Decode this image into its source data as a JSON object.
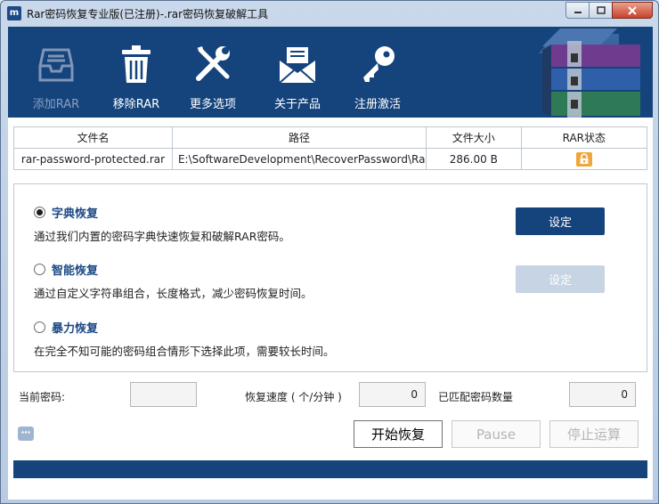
{
  "window": {
    "title": "Rar密码恢复专业版(已注册)-.rar密码恢复破解工具",
    "app_icon_text": "m"
  },
  "toolbar": {
    "items": [
      {
        "label": "添加RAR",
        "icon": "inbox-tray-icon",
        "enabled": false
      },
      {
        "label": "移除RAR",
        "icon": "trash-icon",
        "enabled": true
      },
      {
        "label": "更多选项",
        "icon": "tools-icon",
        "enabled": true
      },
      {
        "label": "关于产品",
        "icon": "envelope-icon",
        "enabled": true
      },
      {
        "label": "注册激活",
        "icon": "key-icon",
        "enabled": true
      }
    ],
    "logo": "rar-archive-logo"
  },
  "file_table": {
    "headers": [
      "文件名",
      "路径",
      "文件大小",
      "RAR状态"
    ],
    "rows": [
      {
        "name": "rar-password-protected.rar",
        "path": "E:\\SoftwareDevelopment\\RecoverPassword\\Rar+Zi",
        "size": "286.00 B",
        "status_icon": "lock-icon"
      }
    ]
  },
  "options": [
    {
      "title": "字典恢复",
      "desc": "通过我们内置的密码字典快速恢复和破解RAR密码。",
      "selected": true,
      "button": "设定",
      "button_enabled": true
    },
    {
      "title": "智能恢复",
      "desc": "通过自定义字符串组合，长度格式，减少密码恢复时间。",
      "selected": false,
      "button": "设定",
      "button_enabled": false
    },
    {
      "title": "暴力恢复",
      "desc": "在完全不知可能的密码组合情形下选择此项，需要较长时间。",
      "selected": false
    }
  ],
  "status": {
    "current_password_label": "当前密码:",
    "current_password_value": "",
    "speed_label": "恢复速度 ( 个/分钟 )",
    "speed_value": "0",
    "matched_label": "已匹配密码数量",
    "matched_value": "0"
  },
  "actions": {
    "start": "开始恢复",
    "pause": "Pause",
    "stop": "停止运算"
  },
  "colors": {
    "brand_blue": "#15437c",
    "title_blue": "#1c4a86",
    "disabled_button": "#c6d4e4",
    "lock_orange": "#f2a53a"
  }
}
